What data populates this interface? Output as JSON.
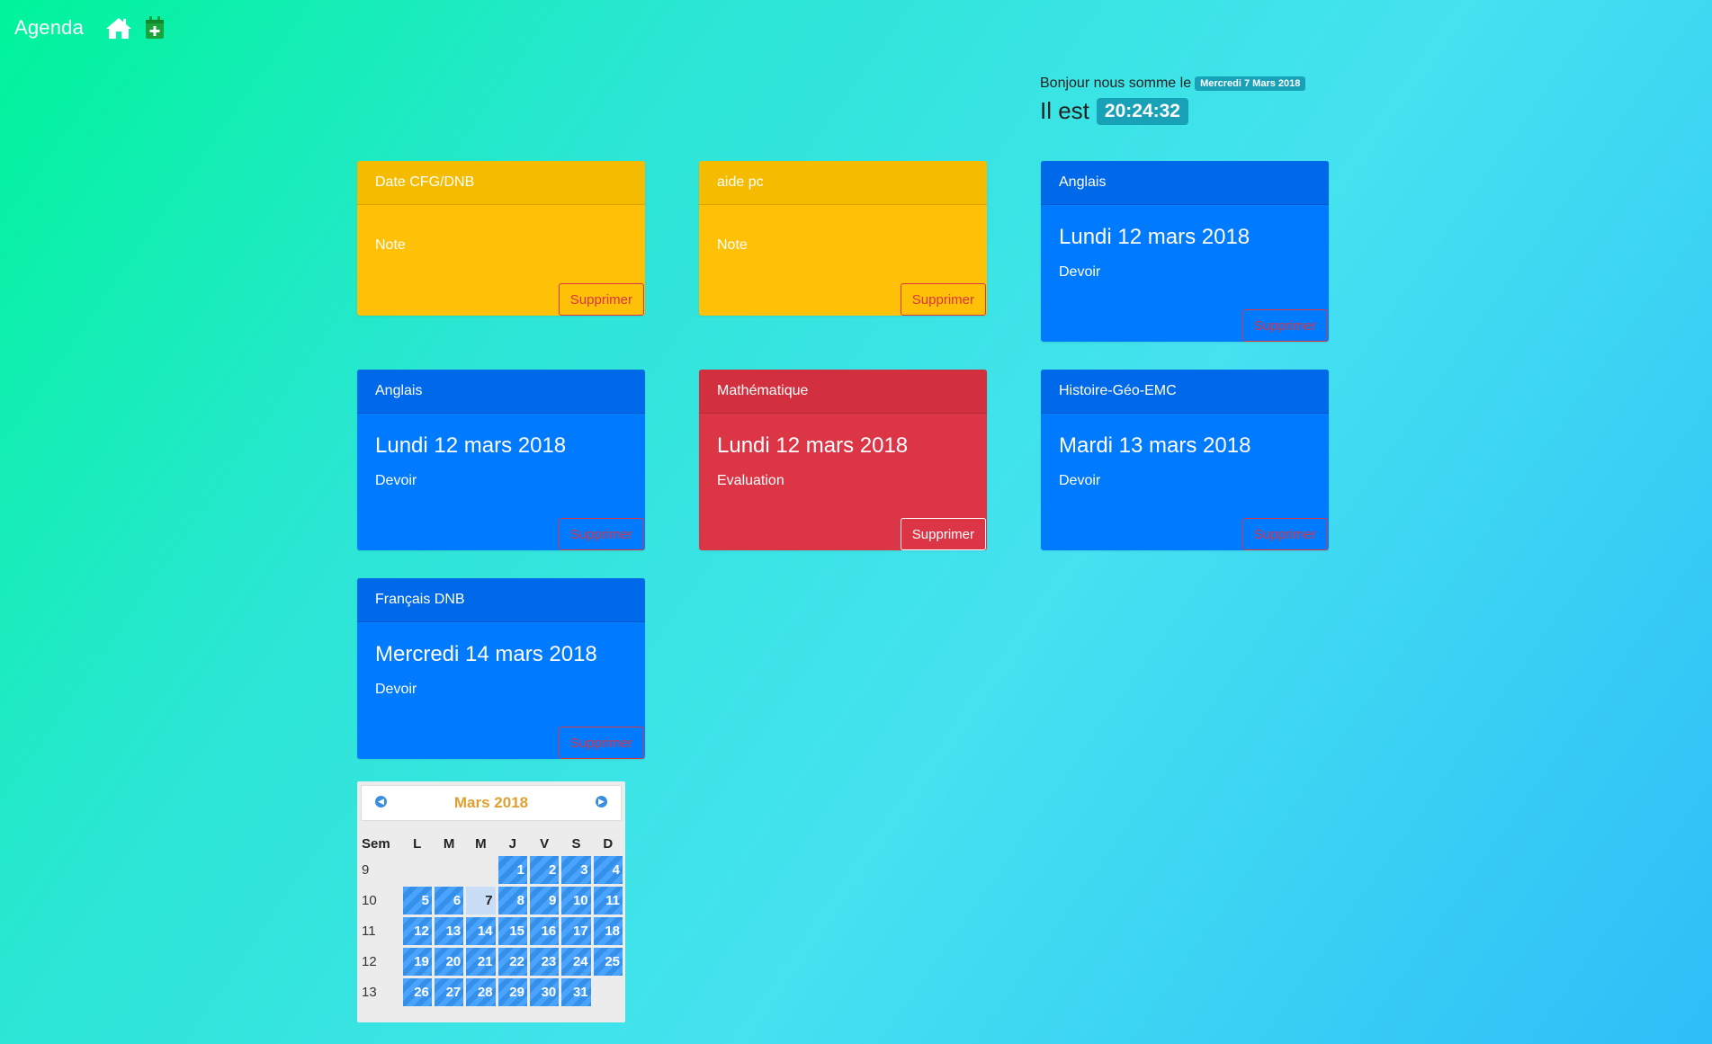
{
  "nav": {
    "brand": "Agenda",
    "icons": [
      {
        "name": "home-icon",
        "color": "#ffffff"
      },
      {
        "name": "calendar-plus-icon",
        "color": "#1aa33a"
      }
    ]
  },
  "greeting": {
    "prefix": "Bonjour nous somme le",
    "date_badge": "Mercredi 7 Mars 2018",
    "time_prefix": "Il est",
    "time_badge": "20:24:32"
  },
  "cards": [
    {
      "variant": "warning",
      "header": "Date CFG/DNB",
      "title": "",
      "text": "Note",
      "button": "Supprimer"
    },
    {
      "variant": "warning",
      "header": "aide pc",
      "title": "",
      "text": "Note",
      "button": "Supprimer"
    },
    {
      "variant": "primary",
      "header": "Anglais",
      "title": "Lundi 12 mars 2018",
      "text": "Devoir",
      "button": "Supprimer"
    },
    {
      "variant": "primary",
      "header": "Anglais",
      "title": "Lundi 12 mars 2018",
      "text": "Devoir",
      "button": "Supprimer"
    },
    {
      "variant": "danger",
      "header": "Mathématique",
      "title": "Lundi 12 mars 2018",
      "text": "Evaluation",
      "button": "Supprimer"
    },
    {
      "variant": "primary",
      "header": "Histoire-Géo-EMC",
      "title": "Mardi 13 mars 2018",
      "text": "Devoir",
      "button": "Supprimer"
    },
    {
      "variant": "primary",
      "header": "Français DNB",
      "title": "Mercredi 14 mars 2018",
      "text": "Devoir",
      "button": "Supprimer"
    }
  ],
  "calendar": {
    "title": "Mars 2018",
    "prev_icon": "chevron-left-icon",
    "next_icon": "chevron-right-icon",
    "headers": [
      "Sem",
      "L",
      "M",
      "M",
      "J",
      "V",
      "S",
      "D"
    ],
    "weeks": [
      {
        "week": "9",
        "days": [
          "",
          "",
          "",
          "1",
          "2",
          "3",
          "4"
        ]
      },
      {
        "week": "10",
        "days": [
          "5",
          "6",
          "7",
          "8",
          "9",
          "10",
          "11"
        ]
      },
      {
        "week": "11",
        "days": [
          "12",
          "13",
          "14",
          "15",
          "16",
          "17",
          "18"
        ]
      },
      {
        "week": "12",
        "days": [
          "19",
          "20",
          "21",
          "22",
          "23",
          "24",
          "25"
        ]
      },
      {
        "week": "13",
        "days": [
          "26",
          "27",
          "28",
          "29",
          "30",
          "31",
          ""
        ]
      }
    ],
    "today": "7"
  }
}
